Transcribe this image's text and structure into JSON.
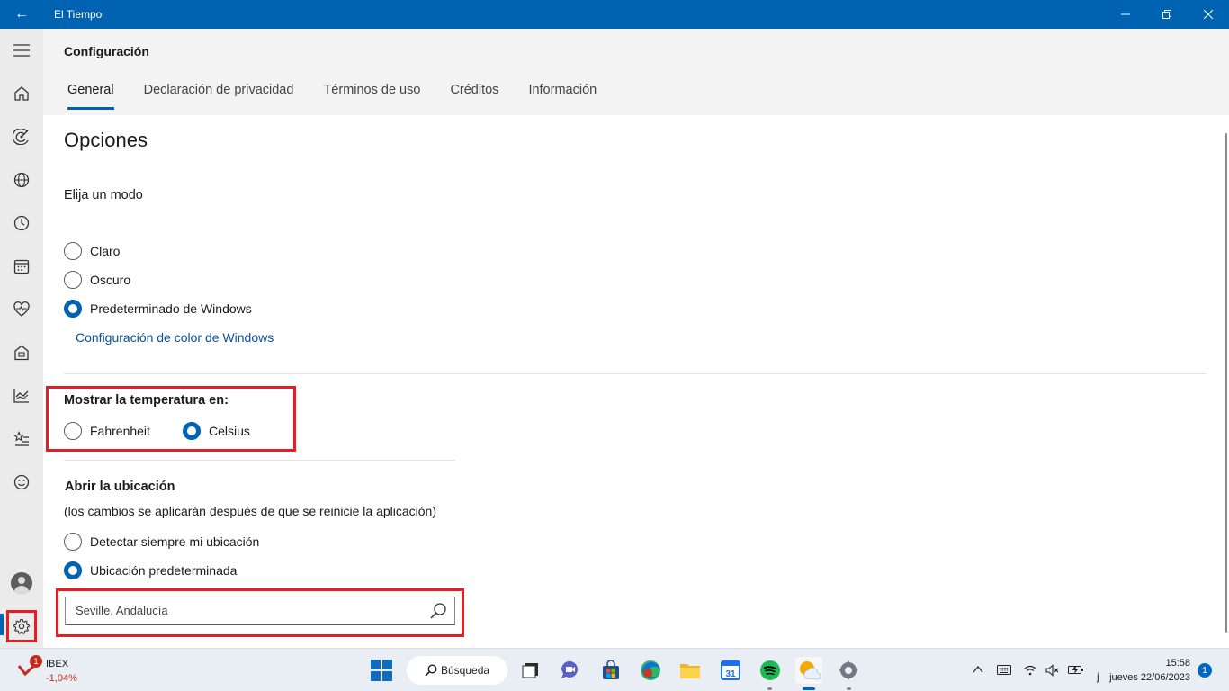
{
  "window": {
    "title": "El Tiempo",
    "back_glyph": "←",
    "controls": [
      "minimize",
      "restore",
      "close"
    ]
  },
  "header": {
    "title": "Configuración",
    "tabs": [
      {
        "label": "General",
        "active": true
      },
      {
        "label": "Declaración de privacidad",
        "active": false
      },
      {
        "label": "Términos de uso",
        "active": false
      },
      {
        "label": "Créditos",
        "active": false
      },
      {
        "label": "Información",
        "active": false
      }
    ]
  },
  "nav": {
    "items": [
      "hamburger-icon",
      "home-icon",
      "radar-icon",
      "globe-icon",
      "clock-icon",
      "calendar-icon",
      "heart-pulse-icon",
      "house-icon",
      "chart-icon",
      "favorites-icon",
      "smiley-icon"
    ],
    "bottom": [
      "avatar",
      "gear-icon"
    ],
    "selected": "gear-icon"
  },
  "options": {
    "heading": "Opciones",
    "mode_label": "Elija un modo",
    "modes": [
      {
        "label": "Claro",
        "checked": false
      },
      {
        "label": "Oscuro",
        "checked": false
      },
      {
        "label": "Predeterminado de Windows",
        "checked": true
      }
    ],
    "color_link": "Configuración de color de Windows"
  },
  "temperature": {
    "heading": "Mostrar la temperatura en:",
    "units": [
      {
        "label": "Fahrenheit",
        "checked": false
      },
      {
        "label": "Celsius",
        "checked": true
      }
    ]
  },
  "location": {
    "heading": "Abrir la ubicación",
    "note": "(los cambios se aplicarán después de que se reinicie la aplicación)",
    "choices": [
      {
        "label": "Detectar siempre mi ubicación",
        "checked": false
      },
      {
        "label": "Ubicación predeterminada",
        "checked": true
      }
    ],
    "search_value": "Seville, Andalucía"
  },
  "taskbar": {
    "widget": {
      "name": "IBEX",
      "value": "-1,04%",
      "badge": "1"
    },
    "search_label": "Búsqueda",
    "tray_text": "j",
    "clock_time": "15:58",
    "clock_date": "jueves 22/06/2023",
    "notification_count": "1",
    "colors": {
      "accent": "#0063b1",
      "highlight_box": "#e31e24",
      "ibex_negative": "#c42b1c"
    }
  }
}
